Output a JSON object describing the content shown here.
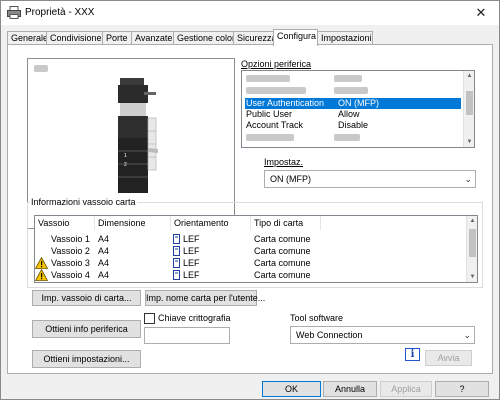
{
  "window": {
    "title": "Proprietà - XXX",
    "close_glyph": "✕"
  },
  "tabs": [
    {
      "label": "Generale"
    },
    {
      "label": "Condivisione"
    },
    {
      "label": "Porte"
    },
    {
      "label": "Avanzate"
    },
    {
      "label": "Gestione colori"
    },
    {
      "label": "Sicurezza"
    },
    {
      "label": "Configura"
    },
    {
      "label": "Impostazioni"
    }
  ],
  "active_tab": "Configura",
  "device_options": {
    "label": "Opzioni periferica",
    "rows": [
      {
        "name": "User Authentication",
        "value": "ON (MFP)",
        "selected": true
      },
      {
        "name": "Public User",
        "value": "Allow",
        "selected": false
      },
      {
        "name": "Account Track",
        "value": "Disable",
        "selected": false
      }
    ],
    "setting_label": "Impostaz.",
    "setting_value": "ON (MFP)"
  },
  "tray_info": {
    "label": "Informazioni vassoio carta",
    "columns": [
      "Vassoio",
      "Dimensione",
      "Orientamento",
      "Tipo di carta"
    ],
    "rows": [
      {
        "tray": "Vassoio 1",
        "size": "A4",
        "orientation": "LEF",
        "type": "Carta comune",
        "warning": false
      },
      {
        "tray": "Vassoio 2",
        "size": "A4",
        "orientation": "LEF",
        "type": "Carta comune",
        "warning": false
      },
      {
        "tray": "Vassoio 3",
        "size": "A4",
        "orientation": "LEF",
        "type": "Carta comune",
        "warning": true
      },
      {
        "tray": "Vassoio 4",
        "size": "A4",
        "orientation": "LEF",
        "type": "Carta comune",
        "warning": true
      }
    ]
  },
  "buttons": {
    "tray_settings": "Imp. vassoio di carta...",
    "paper_name": "Imp. nome carta per l'utente...",
    "get_device_info": "Ottieni info periferica",
    "get_settings": "Ottieni impostazioni...",
    "send": "Avvia",
    "info": "i"
  },
  "encryption": {
    "label": "Chiave crittografia",
    "checked": false,
    "value": ""
  },
  "tool_software": {
    "label": "Tool software",
    "value": "Web Connection"
  },
  "footer": {
    "ok": "OK",
    "cancel": "Annulla",
    "apply": "Applica",
    "help": "?"
  },
  "icons": {
    "title": "printer-icon",
    "warning": "warning-icon",
    "orientation": "page-orientation-icon"
  },
  "colors": {
    "selection": "#0078d7",
    "warning": "#f5c400"
  }
}
